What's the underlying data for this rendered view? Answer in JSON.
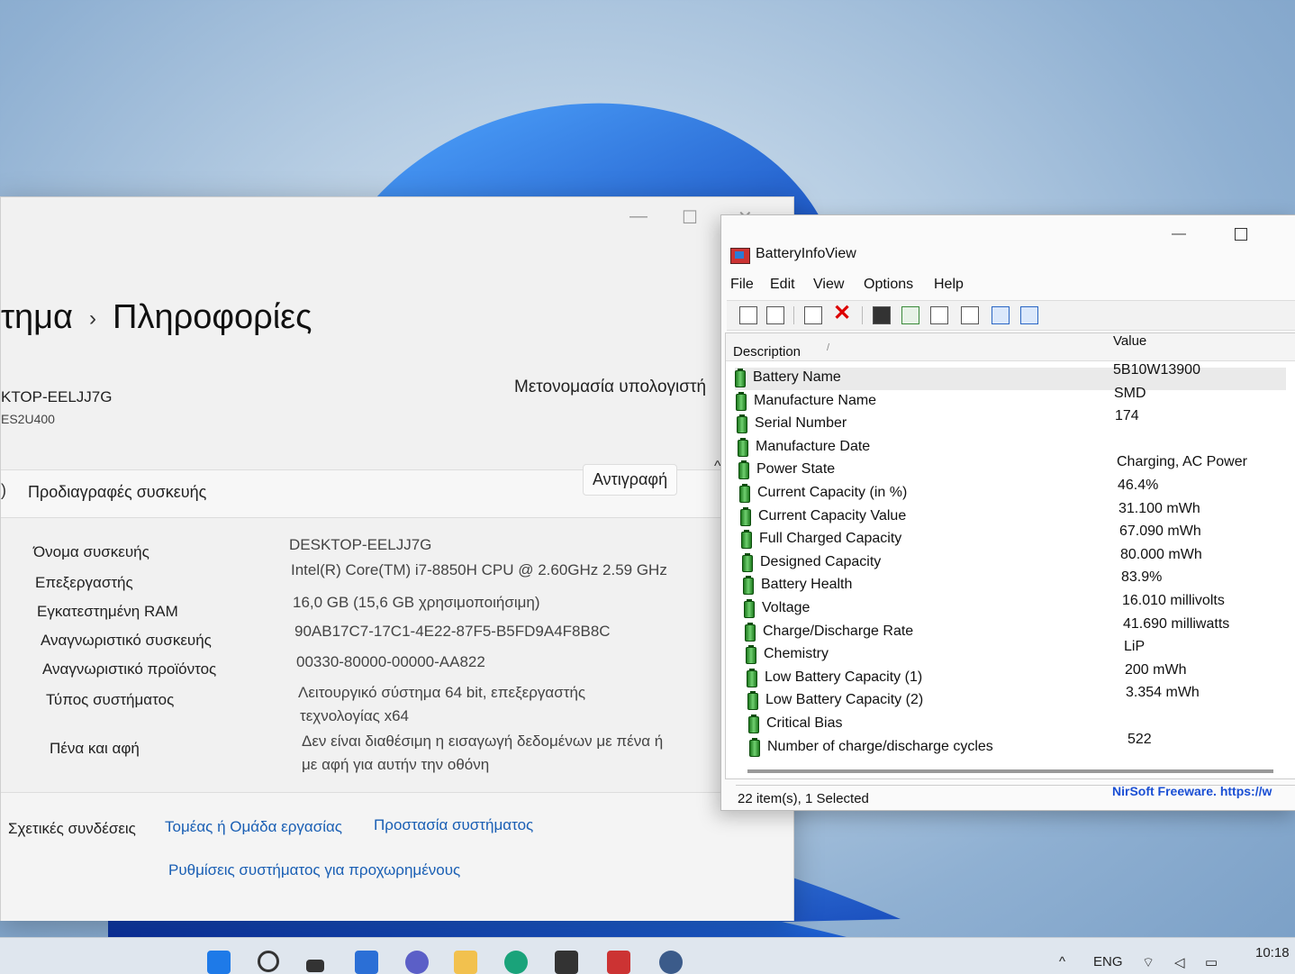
{
  "settings": {
    "window_controls": {
      "minimize": "—",
      "maximize": "☐",
      "close": "✕"
    },
    "breadcrumb": {
      "parent": "τημα",
      "separator": "›",
      "current": "Πληροφορίες"
    },
    "device_name_short": "KTOP-EELJJ7G",
    "device_model": "ES2U400",
    "rename_label": "Μετονομασία υπολογιστή",
    "section_title": "Προδιαγραφές συσκευής",
    "copy_label": "Αντιγραφή",
    "specs": [
      {
        "label": "Όνομα συσκευής",
        "value": "DESKTOP-EELJJ7G"
      },
      {
        "label": "Επεξεργαστής",
        "value": "Intel(R) Core(TM) i7-8850H CPU @ 2.60GHz   2.59 GHz"
      },
      {
        "label": "Εγκατεστημένη RAM",
        "value": "16,0 GB (15,6 GB χρησιμοποιήσιμη)"
      },
      {
        "label": "Αναγνωριστικό συσκευής",
        "value": "90AB17C7-17C1-4E22-87F5-B5FD9A4F8B8C"
      },
      {
        "label": "Αναγνωριστικό προϊόντος",
        "value": "00330-80000-00000-AA822"
      },
      {
        "label": "Τύπος συστήματος",
        "value": "Λειτουργικό σύστημα 64 bit, επεξεργαστής",
        "value2": "τεχνολογίας x64"
      },
      {
        "label": "Πένα και αφή",
        "value": "Δεν είναι διαθέσιμη η εισαγωγή δεδομένων με πένα ή",
        "value2": "με αφή για αυτήν την οθόνη"
      }
    ],
    "related": {
      "label": "Σχετικές συνδέσεις",
      "links": [
        "Τομέας ή Ομάδα εργασίας",
        "Προστασία συστήματος",
        "Ρυθμίσεις συστήματος για προχωρημένους"
      ]
    }
  },
  "biv": {
    "title": "BatteryInfoView",
    "window_controls": {
      "minimize": "—"
    },
    "menu": [
      "File",
      "Edit",
      "View",
      "Options",
      "Help"
    ],
    "columns": {
      "description": "Description",
      "value": "Value"
    },
    "rows": [
      {
        "desc": "Battery Name",
        "value": "5B10W13900"
      },
      {
        "desc": "Manufacture Name",
        "value": "SMD"
      },
      {
        "desc": "Serial Number",
        "value": "174"
      },
      {
        "desc": "Manufacture Date",
        "value": ""
      },
      {
        "desc": "Power State",
        "value": "Charging, AC Power"
      },
      {
        "desc": "Current Capacity (in %)",
        "value": "46.4%"
      },
      {
        "desc": "Current Capacity Value",
        "value": "31.100 mWh"
      },
      {
        "desc": "Full Charged Capacity",
        "value": "67.090 mWh"
      },
      {
        "desc": "Designed Capacity",
        "value": "80.000 mWh"
      },
      {
        "desc": "Battery Health",
        "value": "83.9%"
      },
      {
        "desc": "Voltage",
        "value": "16.010 millivolts"
      },
      {
        "desc": "Charge/Discharge Rate",
        "value": "41.690 milliwatts"
      },
      {
        "desc": "Chemistry",
        "value": "LiP"
      },
      {
        "desc": "Low Battery Capacity (1)",
        "value": "200 mWh"
      },
      {
        "desc": "Low Battery Capacity (2)",
        "value": "3.354 mWh"
      },
      {
        "desc": "Critical Bias",
        "value": ""
      },
      {
        "desc": "Number of charge/discharge cycles",
        "value": "522"
      }
    ],
    "status": "22 item(s), 1 Selected",
    "nirsoft": "NirSoft Freeware. https://w"
  },
  "taskbar": {
    "lang": "ENG",
    "time": "10:18"
  },
  "colors": {
    "accent": "#1a5fb4",
    "nirsoft": "#1a4fd4",
    "battery_green": "#2e9b2e"
  }
}
